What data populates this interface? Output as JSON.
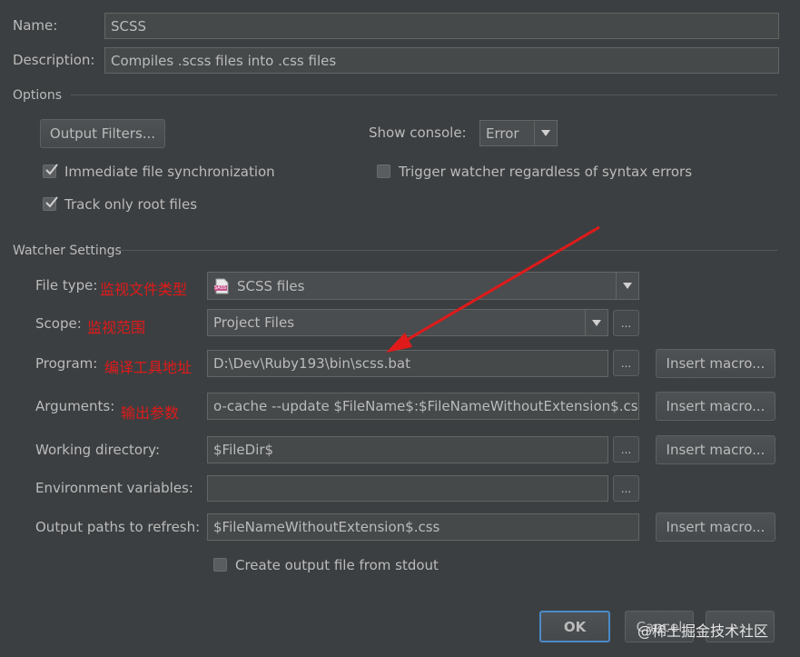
{
  "name": {
    "label": "Name:",
    "value": "SCSS"
  },
  "description": {
    "label": "Description:",
    "value": "Compiles .scss files into .css files"
  },
  "options": {
    "section_title": "Options",
    "output_filters_button": "Output Filters...",
    "show_console_label": "Show console:",
    "show_console_value": "Error",
    "immediate_sync_label": "Immediate file synchronization",
    "immediate_sync_checked": true,
    "trigger_watcher_label": "Trigger watcher regardless of syntax errors",
    "trigger_watcher_checked": false,
    "track_root_label": "Track only root files",
    "track_root_checked": true
  },
  "watcher": {
    "section_title": "Watcher Settings",
    "file_type": {
      "label": "File type:",
      "annotation": "监视文件类型",
      "icon": "sass-file-icon",
      "value": "SCSS files"
    },
    "scope": {
      "label": "Scope:",
      "annotation": "监视范围",
      "value": "Project Files"
    },
    "program": {
      "label": "Program:",
      "annotation": "编译工具地址",
      "value": "D:\\Dev\\Ruby193\\bin\\scss.bat"
    },
    "arguments": {
      "label": "Arguments:",
      "annotation": "输出参数",
      "value": "o-cache --update $FileName$:$FileNameWithoutExtension$.css"
    },
    "working_directory": {
      "label": "Working directory:",
      "value": "$FileDir$"
    },
    "environment_variables": {
      "label": "Environment variables:",
      "value": ""
    },
    "output_paths": {
      "label": "Output paths to refresh:",
      "value": "$FileNameWithoutExtension$.css"
    },
    "create_output_label": "Create output file from stdout",
    "create_output_checked": false,
    "insert_macro_label": "Insert macro...",
    "browse_label": "...",
    "sass_icon_text": "SASS"
  },
  "footer": {
    "ok_label": "OK",
    "cancel_label": "Cancel",
    "watermark": "@稀土掘金技术社区"
  },
  "colors": {
    "annotation_red": "#e01a1a",
    "background": "#3c3f41"
  }
}
